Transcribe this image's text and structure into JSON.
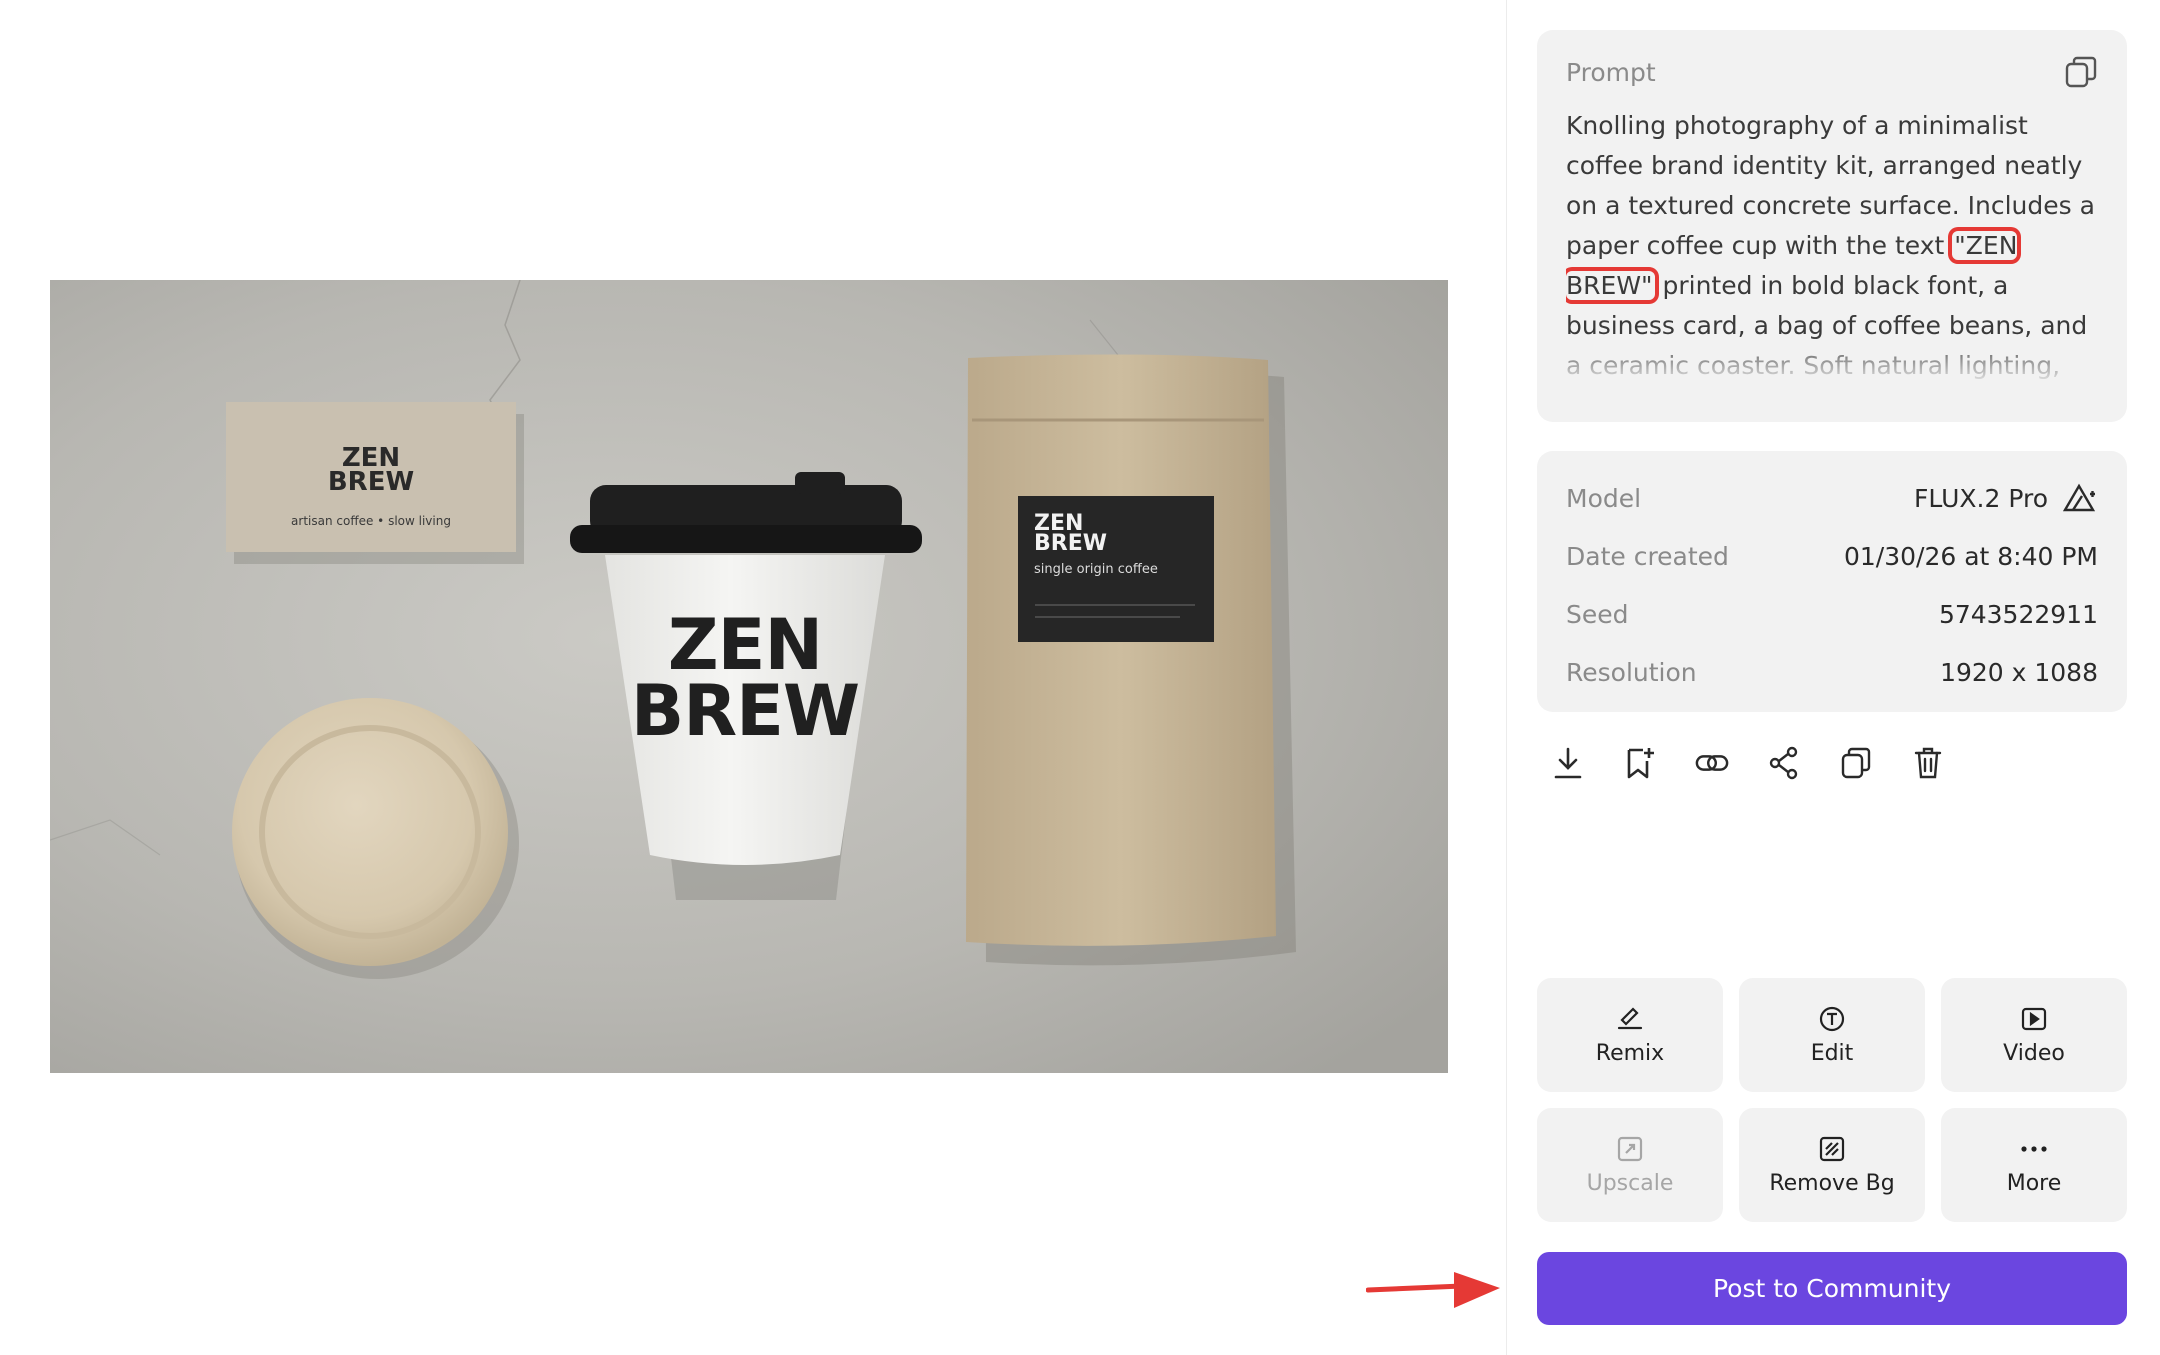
{
  "image": {
    "business_card": {
      "brand_line1": "ZEN",
      "brand_line2": "BREW",
      "tagline": "artisan coffee • slow living"
    },
    "cup": {
      "brand_line1": "ZEN",
      "brand_line2": "BREW"
    },
    "bag": {
      "brand_line1": "ZEN",
      "brand_line2": "BREW",
      "subtitle": "single origin coffee"
    }
  },
  "prompt": {
    "title": "Prompt",
    "text_before": "Knolling photography of a minimalist coffee brand identity kit, arranged neatly on a textured concrete surface. Includes a paper coffee cup with the text ",
    "text_highlight": "\"ZEN BREW\"",
    "text_after": " printed in bold black font, a business card, a bag of coffee beans, and a ceramic coaster. Soft natural lighting, beige and charcoal color"
  },
  "details": {
    "rows": [
      {
        "key": "Model",
        "value": "FLUX.2 Pro"
      },
      {
        "key": "Date created",
        "value": "01/30/26 at 8:40 PM"
      },
      {
        "key": "Seed",
        "value": "5743522911"
      },
      {
        "key": "Resolution",
        "value": "1920 x 1088"
      }
    ]
  },
  "actions": [
    "download-icon",
    "bookmark-add-icon",
    "link-icon",
    "share-icon",
    "copy-icon",
    "trash-icon"
  ],
  "tools": [
    {
      "label": "Remix",
      "icon": "remix-icon",
      "enabled": true
    },
    {
      "label": "Edit",
      "icon": "edit-text-icon",
      "enabled": true
    },
    {
      "label": "Video",
      "icon": "video-icon",
      "enabled": true
    },
    {
      "label": "Upscale",
      "icon": "upscale-icon",
      "enabled": false
    },
    {
      "label": "Remove Bg",
      "icon": "remove-bg-icon",
      "enabled": true
    },
    {
      "label": "More",
      "icon": "more-icon",
      "enabled": true
    }
  ],
  "post_button": "Post to Community",
  "colors": {
    "accent": "#6b46e0",
    "highlight": "#e53935",
    "card_bg": "#f2f2f2"
  }
}
